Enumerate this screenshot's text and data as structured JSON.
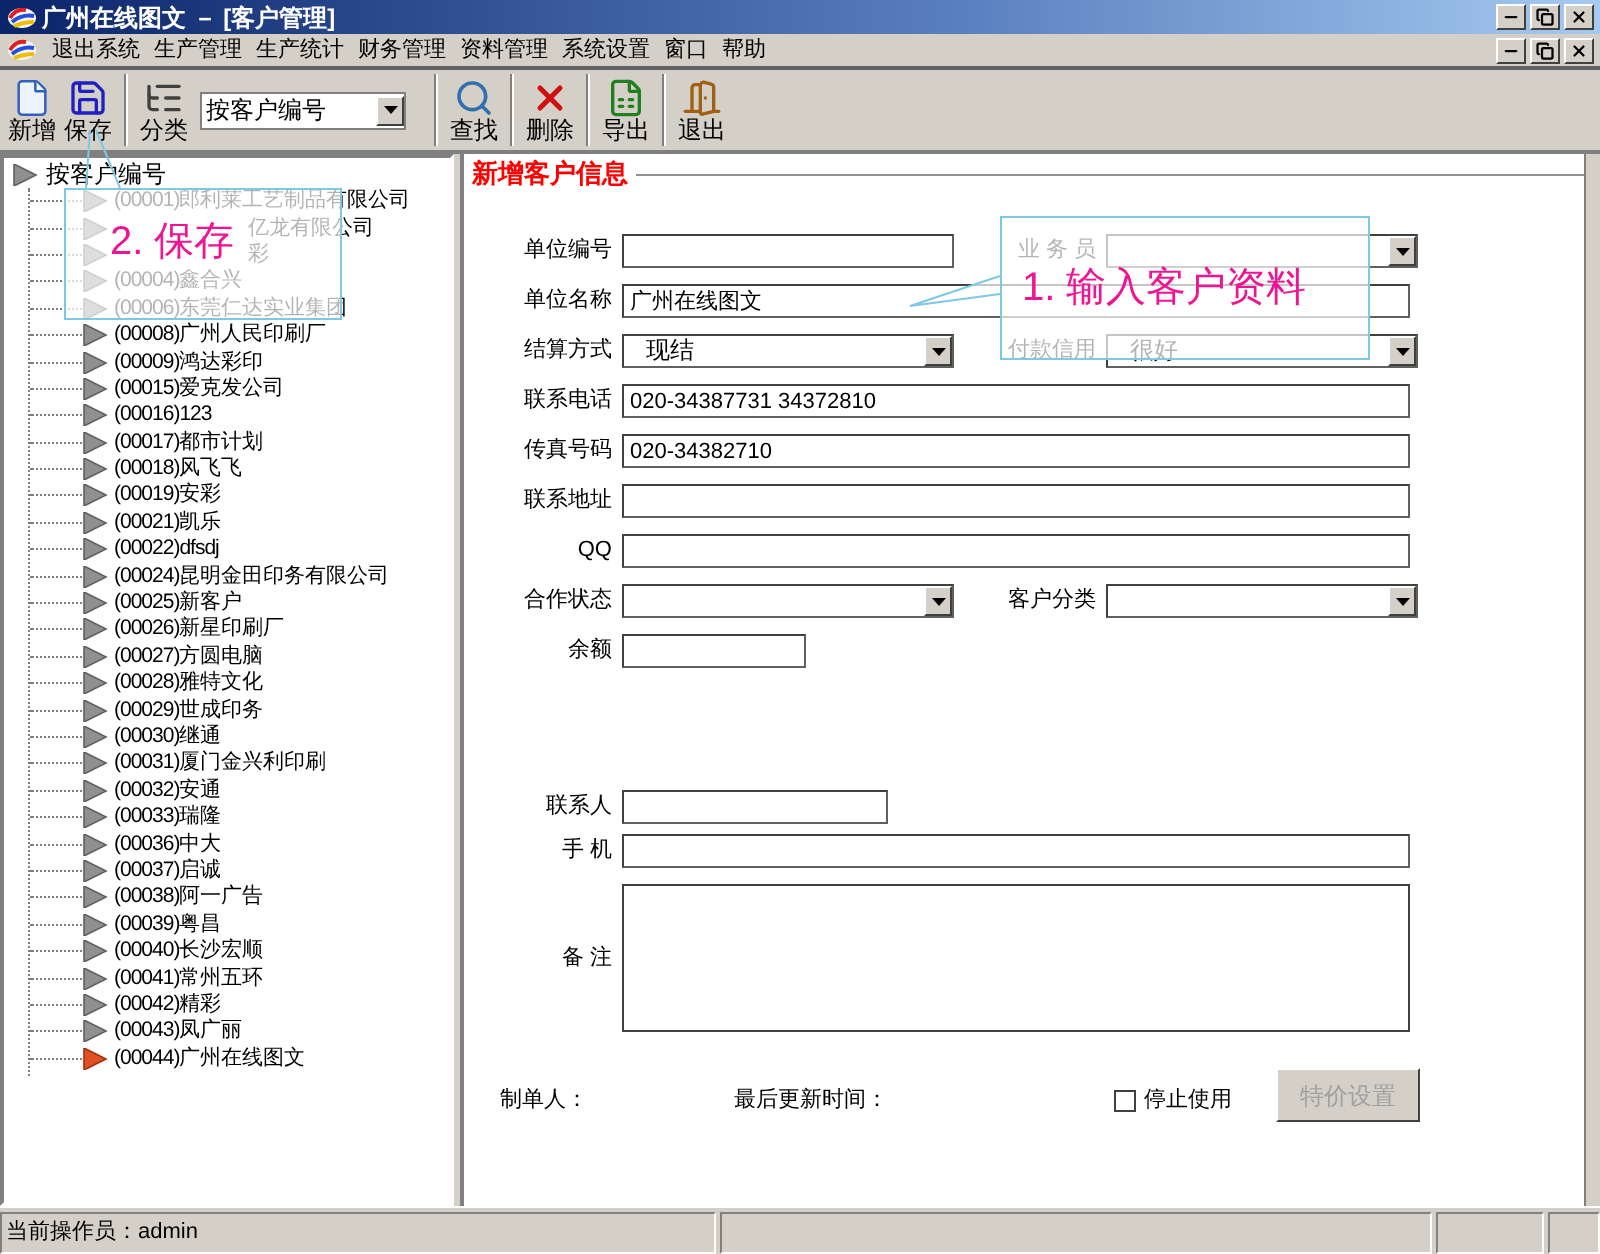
{
  "window": {
    "title": "广州在线图文 － [客户管理]"
  },
  "menu": [
    "退出系统",
    "生产管理",
    "生产统计",
    "财务管理",
    "资料管理",
    "系统设置",
    "窗口",
    "帮助"
  ],
  "toolbar": [
    {
      "kind": "new",
      "label": "新增"
    },
    {
      "kind": "save",
      "label": "保存"
    },
    {
      "kind": "classify",
      "label": "分类"
    },
    {
      "kind": "sort",
      "value": "按客户编号"
    },
    {
      "kind": "find",
      "label": "查找"
    },
    {
      "kind": "delete",
      "label": "删除"
    },
    {
      "kind": "export",
      "label": "导出"
    },
    {
      "kind": "exit",
      "label": "退出"
    }
  ],
  "tree": {
    "root": "按客户编号",
    "items": [
      {
        "label": "(00001)郎利莱工艺制品有限公司",
        "selected": false
      },
      {
        "kind": "cut",
        "label": "亿龙有限公司",
        "selected": false
      },
      {
        "kind": "cut",
        "label": "彩",
        "selected": false
      },
      {
        "label": "(00004)鑫合兴",
        "selected": false
      },
      {
        "label": "(00006)东莞仁达实业集团",
        "selected": false
      },
      {
        "label": "(00008)广州人民印刷厂",
        "selected": false
      },
      {
        "label": "(00009)鸿达彩印",
        "selected": false
      },
      {
        "label": "(00015)爱克发公司",
        "selected": false
      },
      {
        "label": "(00016)123",
        "selected": false
      },
      {
        "label": "(00017)都市计划",
        "selected": false
      },
      {
        "label": "(00018)风飞飞",
        "selected": false
      },
      {
        "label": "(00019)安彩",
        "selected": false
      },
      {
        "label": "(00021)凯乐",
        "selected": false
      },
      {
        "label": "(00022)dfsdj",
        "selected": false
      },
      {
        "label": "(00024)昆明金田印务有限公司",
        "selected": false
      },
      {
        "label": "(00025)新客户",
        "selected": false
      },
      {
        "label": "(00026)新星印刷厂",
        "selected": false
      },
      {
        "label": "(00027)方圆电脑",
        "selected": false
      },
      {
        "label": "(00028)雅特文化",
        "selected": false
      },
      {
        "label": "(00029)世成印务",
        "selected": false
      },
      {
        "label": "(00030)继通",
        "selected": false
      },
      {
        "label": "(00031)厦门金兴利印刷",
        "selected": false
      },
      {
        "label": "(00032)安通",
        "selected": false
      },
      {
        "label": "(00033)瑞隆",
        "selected": false
      },
      {
        "label": "(00036)中大",
        "selected": false
      },
      {
        "label": "(00037)启诚",
        "selected": false
      },
      {
        "label": "(00038)阿一广告",
        "selected": false
      },
      {
        "label": "(00039)粤昌",
        "selected": false
      },
      {
        "label": "(00040)长沙宏顺",
        "selected": false
      },
      {
        "label": "(00041)常州五环",
        "selected": false
      },
      {
        "label": "(00042)精彩",
        "selected": false
      },
      {
        "label": "(00043)凤广丽",
        "selected": false
      },
      {
        "label": "(00044)广州在线图文",
        "selected": true
      }
    ]
  },
  "form": {
    "title": "新增客户信息",
    "fields": [
      {
        "kind": "text",
        "label": "单位编号"
      },
      {
        "kind": "select",
        "label": "业 务 员"
      },
      {
        "kind": "text",
        "label": "单位名称",
        "value": "广州在线图文"
      },
      {
        "kind": "select",
        "label": "结算方式",
        "value": "现结"
      },
      {
        "kind": "select",
        "label": "付款信用",
        "value": "很好"
      },
      {
        "kind": "text",
        "label": "联系电话",
        "value": "020-34387731 34372810"
      },
      {
        "kind": "text",
        "label": "传真号码",
        "value": "020-34382710"
      },
      {
        "kind": "text",
        "label": "联系地址"
      },
      {
        "kind": "text",
        "label": "QQ"
      },
      {
        "kind": "select",
        "label": "合作状态"
      },
      {
        "kind": "select",
        "label": "客户分类"
      },
      {
        "kind": "text",
        "label": "余额"
      },
      {
        "kind": "text",
        "label": "联系人"
      },
      {
        "kind": "text",
        "label": "手 机"
      },
      {
        "kind": "textarea",
        "label": "备 注"
      }
    ],
    "creator_label": "制单人：",
    "updated_label": "最后更新时间：",
    "stop_use": {
      "label": "停止使用",
      "checked": false
    },
    "price_button": {
      "label": "特价设置",
      "disabled": true
    }
  },
  "callouts": [
    {
      "text": "2. 保存"
    },
    {
      "text": "1. 输入客户资料"
    }
  ],
  "status_bar": {
    "operator": "当前操作员：admin"
  }
}
